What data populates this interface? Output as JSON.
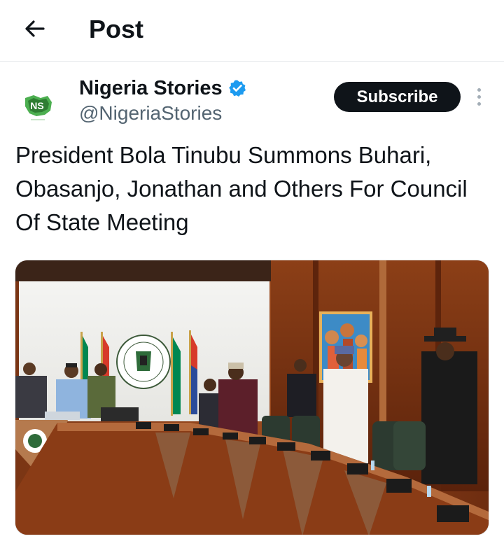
{
  "header": {
    "title": "Post"
  },
  "author": {
    "display_name": "Nigeria Stories",
    "handle": "@NigeriaStories",
    "avatar_text": "NS",
    "verified": true,
    "subscribe_label": "Subscribe"
  },
  "post": {
    "text": "President Bola Tinubu Summons Buhari, Obasanjo, Jonathan and Others For Council Of State Meeting"
  },
  "colors": {
    "accent": "#1d9bf0",
    "button_bg": "#0f1419",
    "secondary_text": "#536471",
    "nigeria_green": "#008751"
  },
  "icons": {
    "back": "arrow-left-icon",
    "verified": "verified-badge-icon",
    "more": "more-vertical-icon"
  }
}
